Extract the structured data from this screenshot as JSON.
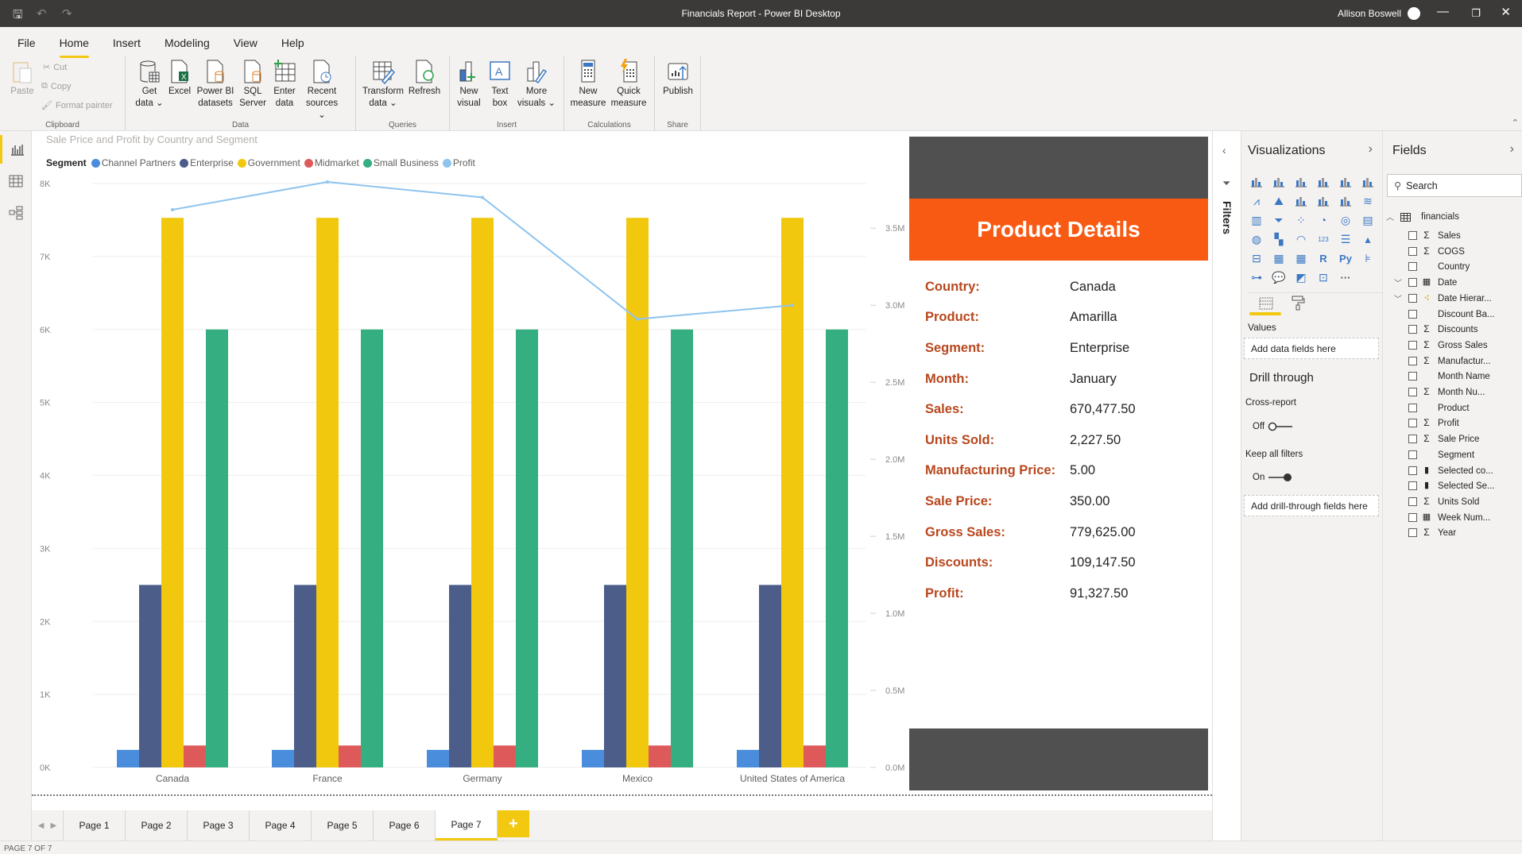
{
  "window": {
    "title": "Financials Report - Power BI Desktop",
    "user": "Allison Boswell"
  },
  "menu": {
    "tabs": [
      "File",
      "Home",
      "Insert",
      "Modeling",
      "View",
      "Help"
    ],
    "active": "Home"
  },
  "ribbon": {
    "clipboard": {
      "paste": "Paste",
      "cut": "Cut",
      "copy": "Copy",
      "format_painter": "Format painter",
      "label": "Clipboard"
    },
    "data": {
      "label": "Data",
      "buttons": [
        {
          "l1": "Get",
          "l2": "data ⌄"
        },
        {
          "l1": "Excel",
          "l2": ""
        },
        {
          "l1": "Power BI",
          "l2": "datasets"
        },
        {
          "l1": "SQL",
          "l2": "Server"
        },
        {
          "l1": "Enter",
          "l2": "data"
        },
        {
          "l1": "Recent",
          "l2": "sources ⌄"
        }
      ]
    },
    "queries": {
      "label": "Queries",
      "buttons": [
        {
          "l1": "Transform",
          "l2": "data ⌄"
        },
        {
          "l1": "Refresh",
          "l2": ""
        }
      ]
    },
    "insert": {
      "label": "Insert",
      "buttons": [
        {
          "l1": "New",
          "l2": "visual"
        },
        {
          "l1": "Text",
          "l2": "box"
        },
        {
          "l1": "More",
          "l2": "visuals ⌄"
        }
      ]
    },
    "calculations": {
      "label": "Calculations",
      "buttons": [
        {
          "l1": "New",
          "l2": "measure"
        },
        {
          "l1": "Quick",
          "l2": "measure"
        }
      ]
    },
    "share": {
      "label": "Share",
      "buttons": [
        {
          "l1": "Publish",
          "l2": ""
        }
      ]
    }
  },
  "chart_data": {
    "type": "bar",
    "title": "Sale Price and Profit by Country and Segment",
    "legend_title": "Segment",
    "legend_position": "top-left",
    "categories": [
      "Canada",
      "France",
      "Germany",
      "Mexico",
      "United States of America"
    ],
    "series": [
      {
        "name": "Channel Partners",
        "color": "#4a8ddc",
        "values": [
          240,
          240,
          240,
          240,
          240
        ]
      },
      {
        "name": "Enterprise",
        "color": "#4c5d8a",
        "values": [
          2500,
          2500,
          2500,
          2500,
          2500
        ]
      },
      {
        "name": "Government",
        "color": "#f2c80f",
        "values": [
          7530,
          7530,
          7530,
          7530,
          7530
        ]
      },
      {
        "name": "Midmarket",
        "color": "#de5a5a",
        "values": [
          300,
          300,
          300,
          300,
          300
        ]
      },
      {
        "name": "Small Business",
        "color": "#35ae81",
        "values": [
          6000,
          6000,
          6000,
          6000,
          6000
        ]
      }
    ],
    "line_series": {
      "name": "Profit",
      "color": "#8fc4ee",
      "axis": "right",
      "values": [
        3620000,
        3800000,
        3700000,
        2910000,
        3000000
      ]
    },
    "y_left": {
      "ylim": [
        0,
        8000
      ],
      "ticks": [
        "0K",
        "1K",
        "2K",
        "3K",
        "4K",
        "5K",
        "6K",
        "7K",
        "8K"
      ]
    },
    "y_right": {
      "ylim": [
        0,
        3700000
      ],
      "ticks": [
        "0.0M",
        "0.5M",
        "1.0M",
        "1.5M",
        "2.0M",
        "2.5M",
        "3.0M",
        "3.5M"
      ]
    },
    "grid": true,
    "xlabel": "",
    "ylabel": ""
  },
  "card": {
    "title": "Product Details",
    "rows": [
      {
        "k": "Country:",
        "v": "Canada"
      },
      {
        "k": "Product:",
        "v": "Amarilla"
      },
      {
        "k": "Segment:",
        "v": "Enterprise"
      },
      {
        "k": "Month:",
        "v": "January"
      },
      {
        "k": "Sales:",
        "v": "670,477.50"
      },
      {
        "k": "Units Sold:",
        "v": "2,227.50"
      },
      {
        "k": "Manufacturing Price:",
        "v": "5.00"
      },
      {
        "k": "Sale Price:",
        "v": "350.00"
      },
      {
        "k": "Gross Sales:",
        "v": "779,625.00"
      },
      {
        "k": "Discounts:",
        "v": "109,147.50"
      },
      {
        "k": "Profit:",
        "v": "91,327.50"
      }
    ]
  },
  "pages": {
    "tabs": [
      "Page 1",
      "Page 2",
      "Page 3",
      "Page 4",
      "Page 5",
      "Page 6",
      "Page 7"
    ],
    "active": "Page 7",
    "add": "+",
    "status": "PAGE 7 OF 7"
  },
  "filters": {
    "label": "Filters"
  },
  "visualizations": {
    "title": "Visualizations",
    "values_label": "Values",
    "values_placeholder": "Add data fields here",
    "drill_title": "Drill through",
    "cross_report": "Cross-report",
    "cross_state": "Off",
    "keep_filters": "Keep all filters",
    "keep_state": "On",
    "drill_placeholder": "Add drill-through fields here",
    "r_label": "R",
    "py_label": "Py",
    "more": "···"
  },
  "fields": {
    "title": "Fields",
    "search_placeholder": "Search",
    "table": "financials",
    "items": [
      {
        "name": "Sales",
        "type": "Σ"
      },
      {
        "name": "COGS",
        "type": "Σ"
      },
      {
        "name": "Country",
        "type": ""
      },
      {
        "name": "Date",
        "type": "cal",
        "expand": true
      },
      {
        "name": "Date Hierar...",
        "type": "hier",
        "expand": true
      },
      {
        "name": "Discount Ba...",
        "type": ""
      },
      {
        "name": "Discounts",
        "type": "Σ"
      },
      {
        "name": "Gross Sales",
        "type": "Σ"
      },
      {
        "name": "Manufactur...",
        "type": "Σ"
      },
      {
        "name": "Month Name",
        "type": ""
      },
      {
        "name": "Month Nu...",
        "type": "Σ"
      },
      {
        "name": "Product",
        "type": ""
      },
      {
        "name": "Profit",
        "type": "Σ"
      },
      {
        "name": "Sale Price",
        "type": "Σ"
      },
      {
        "name": "Segment",
        "type": ""
      },
      {
        "name": "Selected co...",
        "type": "calc"
      },
      {
        "name": "Selected Se...",
        "type": "calc"
      },
      {
        "name": "Units Sold",
        "type": "Σ"
      },
      {
        "name": "Week Num...",
        "type": "cal"
      },
      {
        "name": "Year",
        "type": "Σ"
      }
    ]
  }
}
